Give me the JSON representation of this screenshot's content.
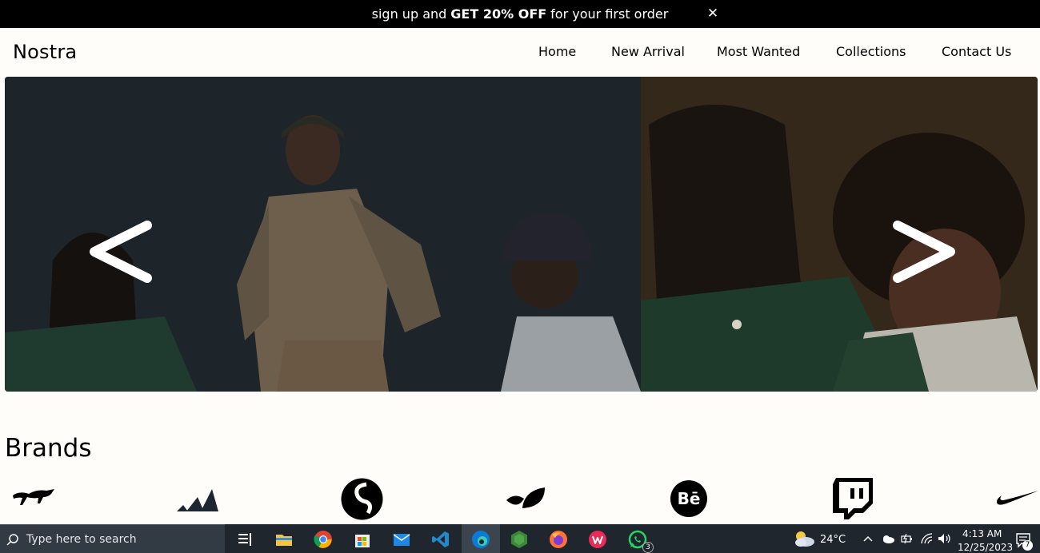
{
  "promo": {
    "text_before": "sign up and",
    "text_bold": "GET 20% OFF",
    "text_after": "for your first order",
    "close_glyph": "✕"
  },
  "header": {
    "logo": "Nostra",
    "nav": [
      "Home",
      "New Arrival",
      "Most Wanted",
      "Collections",
      "Contact Us"
    ]
  },
  "hero": {
    "prev_icon": "chevron-left-icon",
    "next_icon": "chevron-right-icon"
  },
  "brands": {
    "title": "Brands",
    "logos": [
      "puma-icon",
      "adidas-icon",
      "simplenote-icon",
      "leaf-icon",
      "behance-icon",
      "twitch-icon",
      "nike-icon"
    ]
  },
  "taskbar": {
    "search_placeholder": "Type here to search",
    "apps": [
      "task-view-icon",
      "file-explorer-icon",
      "chrome-icon",
      "microsoft-store-icon",
      "mail-icon",
      "vscode-icon",
      "edge-icon",
      "nodejs-icon",
      "firefox-icon",
      "wps-office-icon",
      "whatsapp-icon"
    ],
    "whatsapp_badge": "3",
    "weather": "24°C",
    "time": "4:13 AM",
    "date": "12/25/2023",
    "notification_count": "7"
  }
}
